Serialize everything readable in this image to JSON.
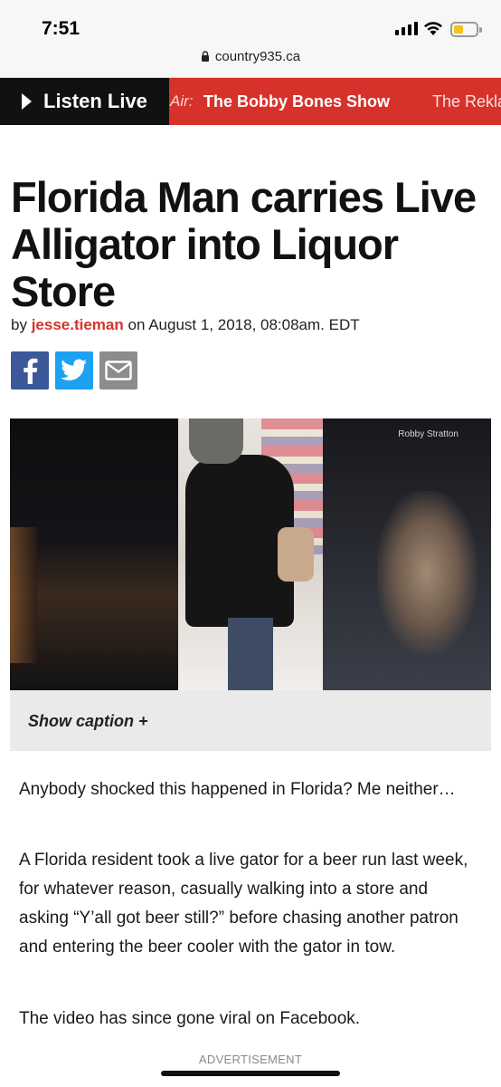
{
  "status": {
    "time": "7:51",
    "battery_color": "#f4c21b"
  },
  "browser": {
    "url": "country935.ca"
  },
  "listen_bar": {
    "listen_label": "Listen Live",
    "air_label": "Air:",
    "show_name": "The Bobby Bones Show",
    "next_show": "The Rekla",
    "bar_color": "#d6322b"
  },
  "article": {
    "headline": "Florida Man carries Live Alligator into Liquor Store",
    "byline_prefix": "by",
    "author": "jesse.tieman",
    "date": "on August 1, 2018, 08:08am. EDT",
    "share": {
      "facebook_icon": "facebook-icon",
      "twitter_icon": "twitter-icon",
      "email_icon": "email-icon"
    },
    "video_credit": "Robby Stratton",
    "caption_toggle": "Show caption +",
    "paragraphs": [
      "Anybody shocked this happened in Florida? Me neither…",
      "A Florida resident took a live gator for a beer run last week, for whatever reason, casually walking into a store and asking “Y’all got beer still?” before chasing another patron and entering the beer cooler with the gator in tow.",
      "The video has since gone viral on Facebook."
    ],
    "ad_label": "ADVERTISEMENT"
  }
}
